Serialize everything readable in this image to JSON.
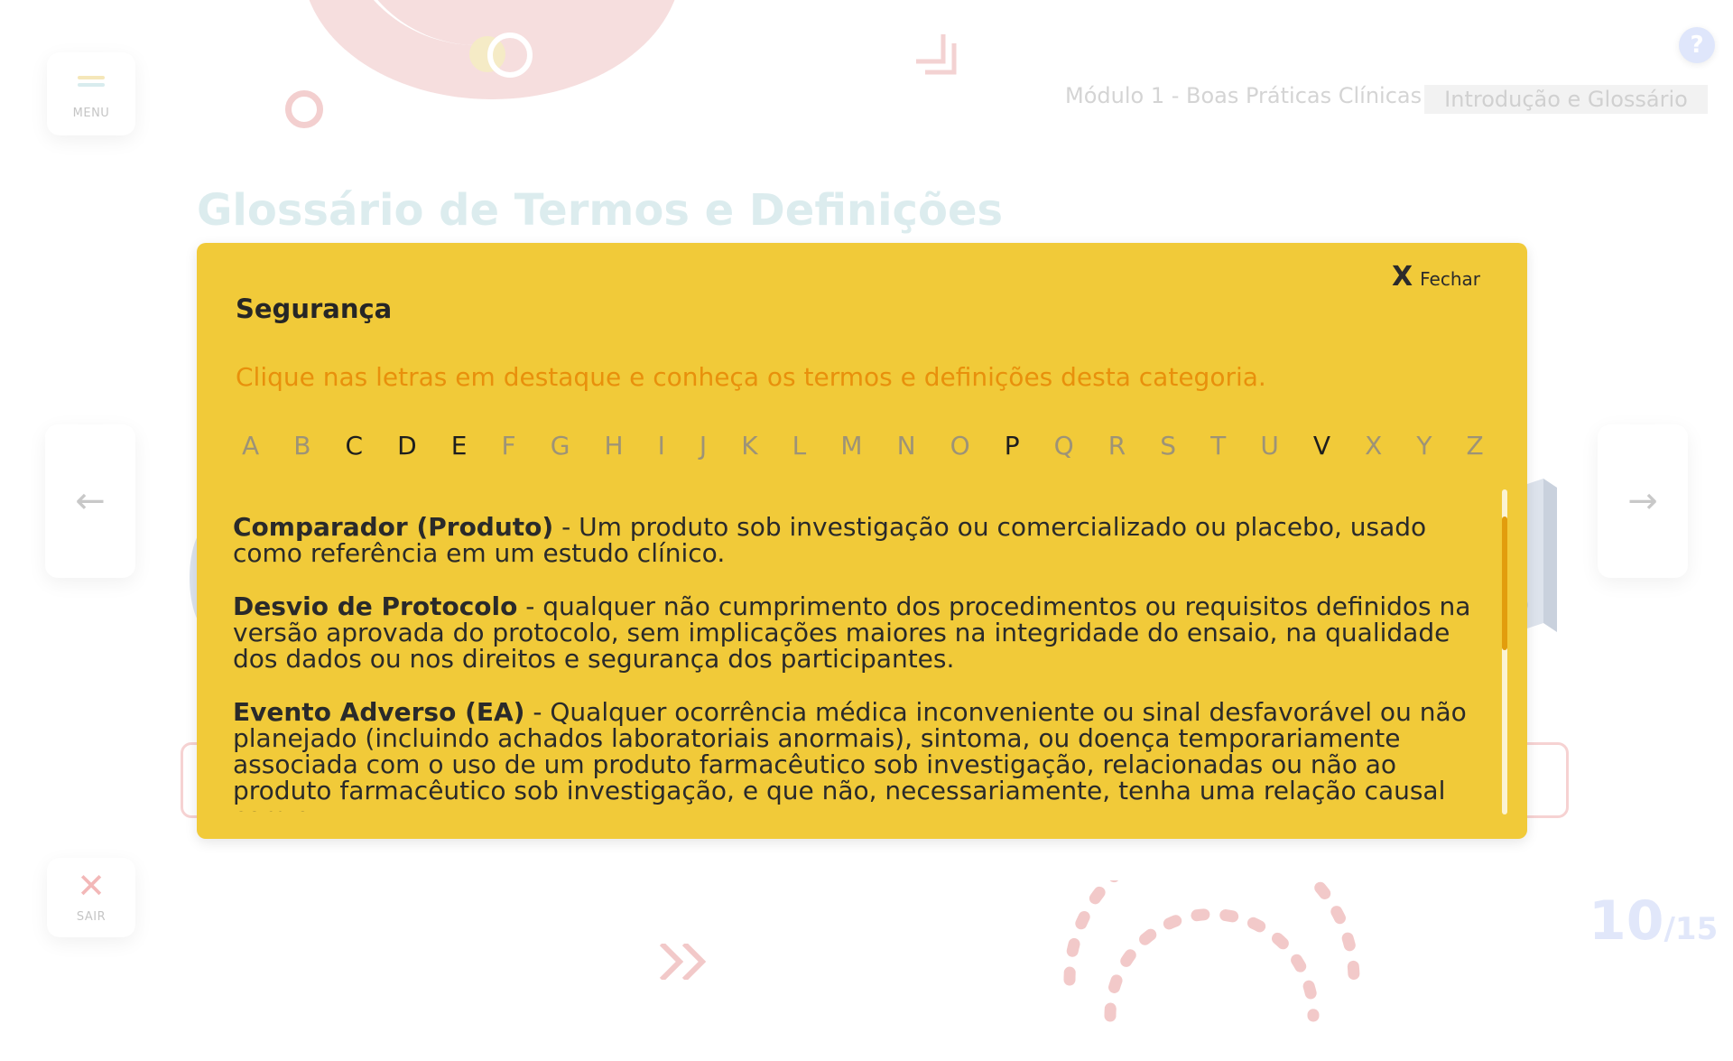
{
  "header": {
    "module": "Módulo 1 - Boas Práticas Clínicas",
    "section": "Introdução e Glossário",
    "help_label": "?"
  },
  "sidebar": {
    "menu_label": "MENU",
    "exit_label": "SAIR"
  },
  "page": {
    "title": "Glossário de Termos e Definições",
    "current": "10",
    "total": "/15"
  },
  "modal": {
    "close_label": "Fechar",
    "close_x": "X",
    "title": "Segurança",
    "subtitle": "Clique nas letras em destaque e conheça os termos e definições desta categoria.",
    "letters": [
      {
        "l": "A",
        "on": false
      },
      {
        "l": "B",
        "on": false
      },
      {
        "l": "C",
        "on": true
      },
      {
        "l": "D",
        "on": true
      },
      {
        "l": "E",
        "on": true
      },
      {
        "l": "F",
        "on": false
      },
      {
        "l": "G",
        "on": false
      },
      {
        "l": "H",
        "on": false
      },
      {
        "l": "I",
        "on": false
      },
      {
        "l": "J",
        "on": false
      },
      {
        "l": "K",
        "on": false
      },
      {
        "l": "L",
        "on": false
      },
      {
        "l": "M",
        "on": false
      },
      {
        "l": "N",
        "on": false
      },
      {
        "l": "O",
        "on": false
      },
      {
        "l": "P",
        "on": true
      },
      {
        "l": "Q",
        "on": false
      },
      {
        "l": "R",
        "on": false
      },
      {
        "l": "S",
        "on": false
      },
      {
        "l": "T",
        "on": false
      },
      {
        "l": "U",
        "on": false
      },
      {
        "l": "V",
        "on": true
      },
      {
        "l": "X",
        "on": false
      },
      {
        "l": "Y",
        "on": false
      },
      {
        "l": "Z",
        "on": false
      }
    ],
    "terms": [
      {
        "term": "Comparador (Produto)",
        "definition": " - Um produto sob investigação ou comercializado ou placebo, usado como referência em um estudo clínico."
      },
      {
        "term": "Desvio de Protocolo",
        "definition": " - qualquer não cumprimento dos procedimentos ou requisitos definidos na versão aprovada do protocolo, sem implicações maiores na integridade do ensaio, na qualidade dos dados ou nos direitos e segurança dos participantes."
      },
      {
        "term": "Evento Adverso (EA)",
        "definition": " - Qualquer ocorrência médica inconveniente ou sinal desfavorável ou não planejado (incluindo achados laboratoriais anormais), sintoma, ou doença temporariamente associada com o uso de um produto farmacêutico sob investigação, relacionadas ou não ao produto farmacêutico sob investigação, e que não, necessariamente, tenha uma relação causal com o"
      }
    ]
  },
  "colors": {
    "modal_bg": "#f1ca39",
    "subtitle": "#e8900c",
    "scroll_thumb": "#e29d0d",
    "letter_active": "#1e1e1e",
    "letter_inactive": "#9d9377"
  },
  "icons": {
    "menu": "hamburger-menu-icon",
    "exit": "close-x-icon",
    "prev": "arrow-left-icon",
    "next": "arrow-right-icon",
    "help": "question-mark-icon"
  }
}
